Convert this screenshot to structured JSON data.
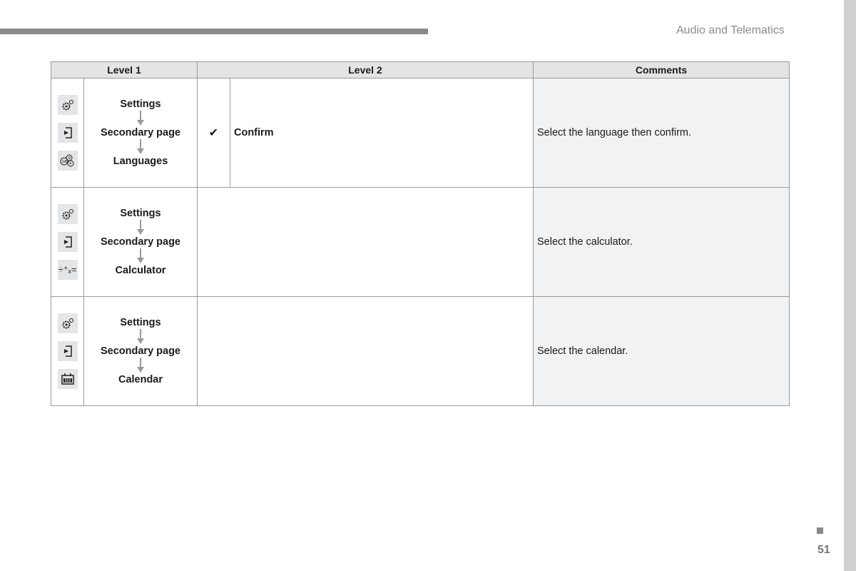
{
  "header": {
    "title": "Audio and Telematics"
  },
  "footer": {
    "page_number": "51"
  },
  "table": {
    "columns": [
      "Level 1",
      "Level 2",
      "Comments"
    ],
    "rows": [
      {
        "icons": [
          "settings-icon",
          "secondary-page-icon",
          "languages-icon"
        ],
        "path": [
          "Settings",
          "Secondary page",
          "Languages"
        ],
        "level2_check": "✔",
        "level2_label": "Confirm",
        "comment": "Select the language then confirm."
      },
      {
        "icons": [
          "settings-icon",
          "secondary-page-icon",
          "calculator-icon"
        ],
        "path": [
          "Settings",
          "Secondary page",
          "Calculator"
        ],
        "level2_check": "",
        "level2_label": "",
        "comment": "Select the calculator."
      },
      {
        "icons": [
          "settings-icon",
          "secondary-page-icon",
          "calendar-icon"
        ],
        "path": [
          "Settings",
          "Secondary page",
          "Calendar"
        ],
        "level2_check": "",
        "level2_label": "",
        "comment": "Select the calendar."
      }
    ],
    "calculator_glyph": "÷⁺ₓ="
  }
}
